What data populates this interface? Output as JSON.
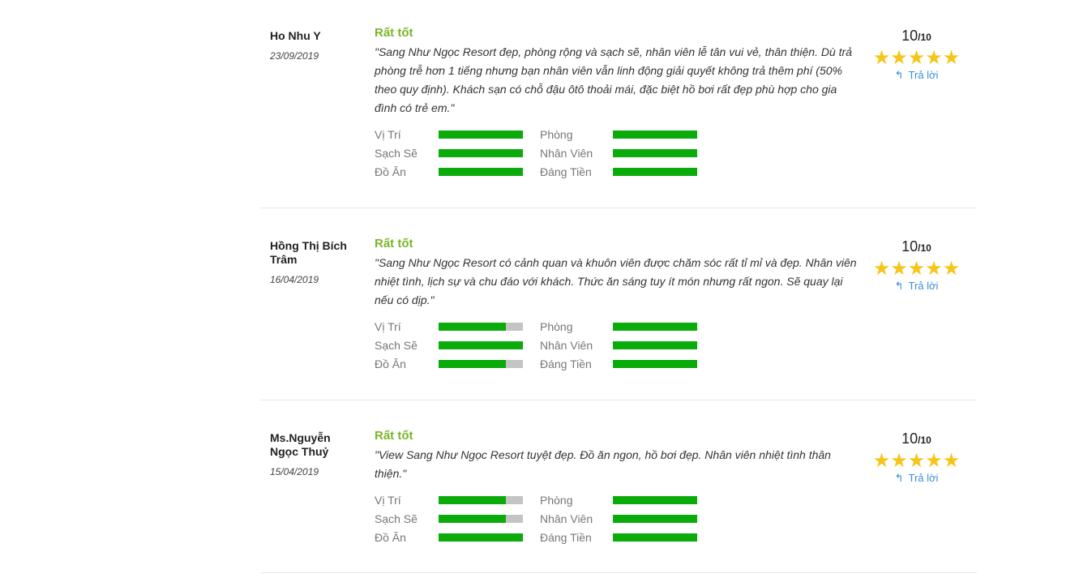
{
  "reviews": [
    {
      "author": "Ho Nhu Y",
      "date": "23/09/2019",
      "verdict": "Rất tốt",
      "comment": "\"Sang Như Ngọc Resort đẹp, phòng rộng và sạch sẽ, nhân viên lễ tân vui vẻ, thân thiện. Dù trả phòng trễ hơn 1 tiếng nhưng bạn nhân viên vẫn linh động giải quyết không trả thêm phí (50% theo quy định). Khách sạn có chỗ đậu ôtô thoải mái, đặc biệt hồ bơi rất đẹp phù hợp cho gia đình có trẻ em.\"",
      "score": "10",
      "score_max": "/10",
      "stars": 5,
      "reply_label": "Trả lời",
      "ratings": [
        {
          "label": "Vị Trí",
          "value": 1.0
        },
        {
          "label": "Phòng",
          "value": 1.0
        },
        {
          "label": "Sạch Sẽ",
          "value": 1.0
        },
        {
          "label": "Nhân Viên",
          "value": 1.0
        },
        {
          "label": "Đồ Ăn",
          "value": 1.0
        },
        {
          "label": "Đáng Tiền",
          "value": 1.0
        }
      ]
    },
    {
      "author": "Hồng Thị Bích Trâm",
      "date": "16/04/2019",
      "verdict": "Rất tốt",
      "comment": "\"Sang Như Ngọc Resort có cảnh quan và khuôn viên được chăm sóc rất tỉ mỉ và đẹp. Nhân viên nhiệt tình, lịch sự và chu đáo với khách. Thức ăn sáng tuy ít món nhưng rất ngon. Sẽ quay lại nếu có dịp.\"",
      "score": "10",
      "score_max": "/10",
      "stars": 5,
      "reply_label": "Trả lời",
      "ratings": [
        {
          "label": "Vị Trí",
          "value": 0.8
        },
        {
          "label": "Phòng",
          "value": 1.0
        },
        {
          "label": "Sạch Sẽ",
          "value": 1.0
        },
        {
          "label": "Nhân Viên",
          "value": 1.0
        },
        {
          "label": "Đồ Ăn",
          "value": 0.8
        },
        {
          "label": "Đáng Tiền",
          "value": 1.0
        }
      ]
    },
    {
      "author": "Ms.Nguyễn Ngọc Thuỷ",
      "date": "15/04/2019",
      "verdict": "Rất tốt",
      "comment": "\"View Sang Như Ngọc Resort tuyệt đẹp. Đồ ăn ngon, hồ bơi đẹp. Nhân viên nhiệt tình thân thiện.\"",
      "score": "10",
      "score_max": "/10",
      "stars": 5,
      "reply_label": "Trả lời",
      "ratings": [
        {
          "label": "Vị Trí",
          "value": 0.8
        },
        {
          "label": "Phòng",
          "value": 1.0
        },
        {
          "label": "Sạch Sẽ",
          "value": 0.8
        },
        {
          "label": "Nhân Viên",
          "value": 1.0
        },
        {
          "label": "Đồ Ăn",
          "value": 1.0
        },
        {
          "label": "Đáng Tiền",
          "value": 1.0
        }
      ]
    }
  ],
  "colors": {
    "verdict": "#7ab52a",
    "bar_fill": "#0bab0b",
    "bar_track": "#c4c4c4",
    "star": "#f5c518",
    "reply_link": "#3a8fd4"
  },
  "icons": {
    "reply": "reply-arrow-icon",
    "star": "star-icon"
  }
}
